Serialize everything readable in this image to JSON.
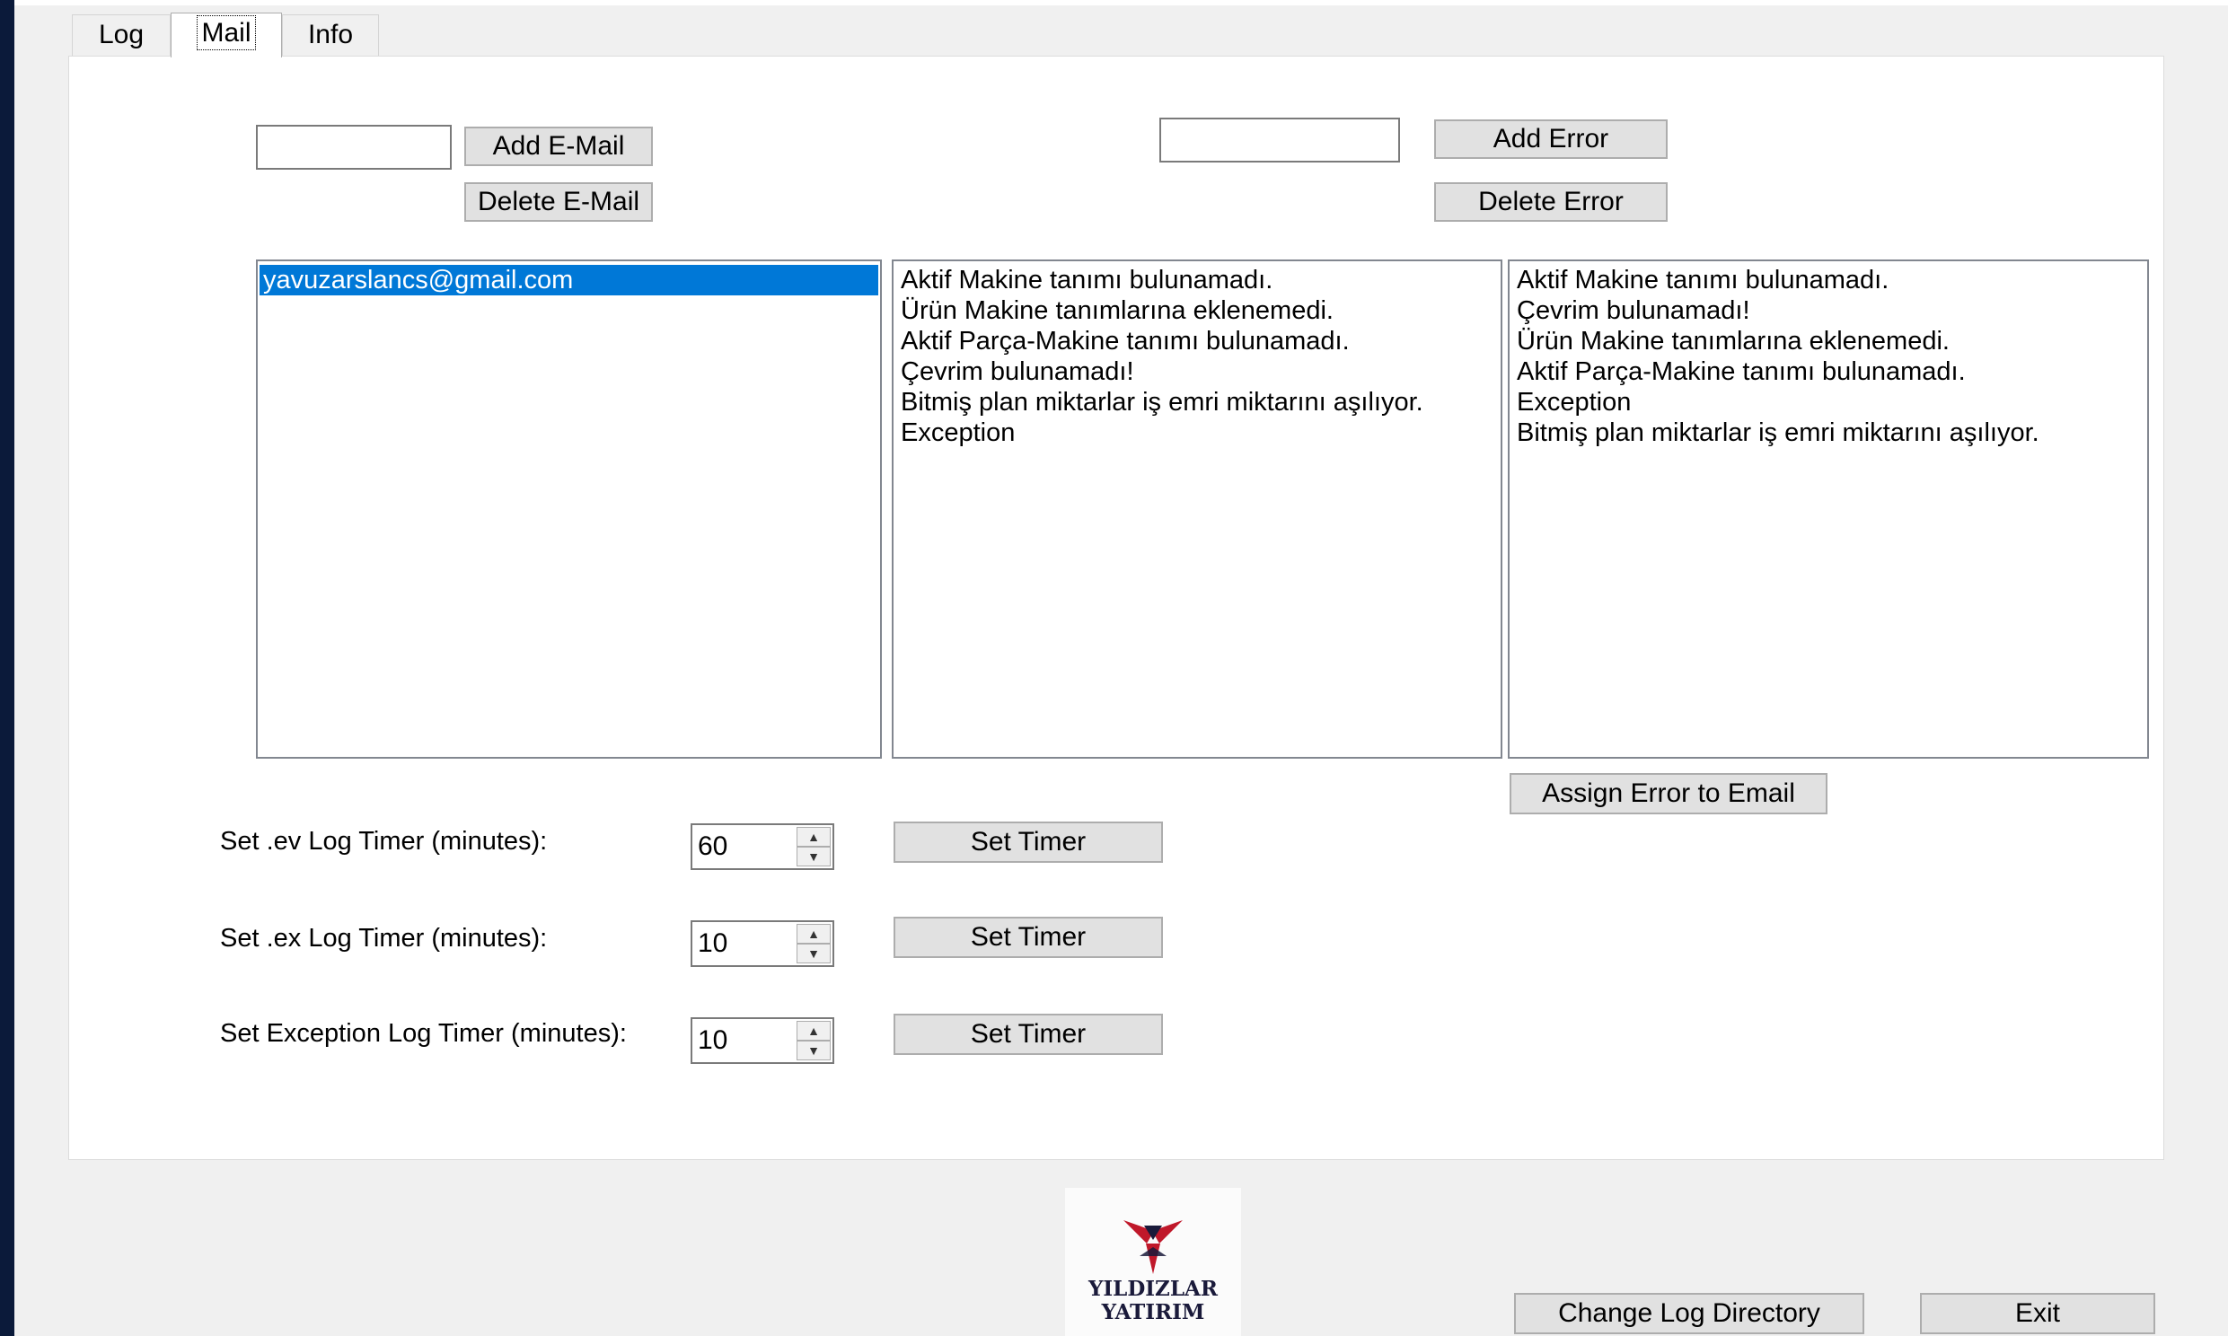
{
  "tabs": [
    {
      "label": "Log"
    },
    {
      "label": "Mail"
    },
    {
      "label": "Info"
    }
  ],
  "mail": {
    "email_input_value": "",
    "add_email_label": "Add E-Mail",
    "delete_email_label": "Delete E-Mail",
    "error_input_value": "",
    "add_error_label": "Add Error",
    "delete_error_label": "Delete Error",
    "assign_label": "Assign Error to Email",
    "emails": [
      "yavuzarslancs@gmail.com"
    ],
    "errors": [
      "Aktif Makine tanımı bulunamadı.",
      "Ürün Makine tanımlarına eklenemedi.",
      "Aktif Parça-Makine tanımı bulunamadı.",
      "Çevrim bulunamadı!",
      "Bitmiş plan miktarlar iş emri miktarını aşılıyor.",
      "Exception"
    ],
    "assigned_errors": [
      "Aktif Makine tanımı bulunamadı.",
      "Çevrim bulunamadı!",
      "Ürün Makine tanımlarına eklenemedi.",
      "Aktif Parça-Makine tanımı bulunamadı.",
      "Exception",
      "Bitmiş plan miktarlar iş emri miktarını aşılıyor."
    ]
  },
  "timers": [
    {
      "label": "Set .ev Log Timer (minutes):",
      "value": "60",
      "button": "Set Timer"
    },
    {
      "label": "Set .ex Log Timer (minutes):",
      "value": "10",
      "button": "Set Timer"
    },
    {
      "label": "Set Exception Log Timer (minutes):",
      "value": "10",
      "button": "Set Timer"
    }
  ],
  "footer": {
    "logo_line1": "YILDIZLAR",
    "logo_line2": "YATIRIM",
    "change_dir_label": "Change Log Directory",
    "exit_label": "Exit"
  },
  "colors": {
    "selection": "#0078d7",
    "logo_red": "#c0182a"
  }
}
